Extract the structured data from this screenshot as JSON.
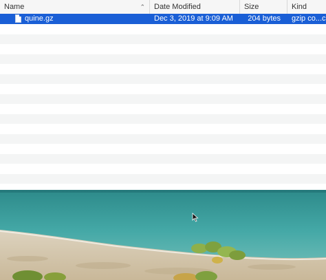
{
  "columns": {
    "name": "Name",
    "date_modified": "Date Modified",
    "size": "Size",
    "kind": "Kind"
  },
  "files": [
    {
      "name": "quine.gz",
      "date_modified": "Dec 3, 2019 at 9:09 AM",
      "size": "204 bytes",
      "kind": "gzip co...ck..."
    }
  ],
  "colors": {
    "selection": "#1a5fd6",
    "stripe": "#f4f5f5",
    "header_bg": "#f6f6f6"
  },
  "icons": {
    "sort": "chevron-up-icon",
    "file": "document-icon",
    "cursor": "mouse-pointer-icon"
  }
}
